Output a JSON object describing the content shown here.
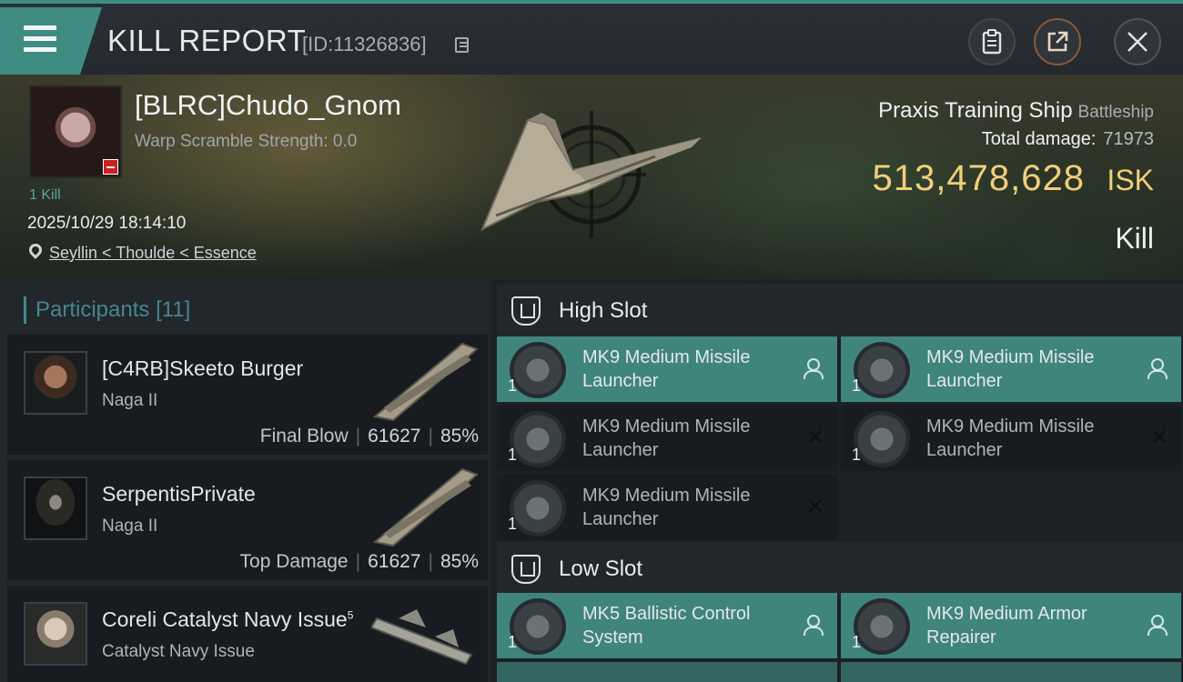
{
  "header": {
    "title": "KILL REPORT",
    "report_id": "[ID:11326836]"
  },
  "victim": {
    "pilot_name": "[BLRC]Chudo_Gnom",
    "warp_scramble": "Warp Scramble Strength: 0.0",
    "kill_count": "1 Kill",
    "datetime": "2025/10/29 18:14:10",
    "location": "Seyllin < Thoulde < Essence",
    "ship_name": "Praxis Training Ship",
    "ship_class": "Battleship",
    "total_damage_label": "Total damage:",
    "total_damage": "71973",
    "isk_value": "513,478,628",
    "isk_unit": "ISK",
    "result": "Kill"
  },
  "participants": {
    "title": "Participants",
    "count": "[11]",
    "rows": [
      {
        "name": "[C4RB]Skeeto Burger",
        "ship": "Naga II",
        "label": "Final Blow",
        "damage": "61627",
        "percent": "85%"
      },
      {
        "name": "SerpentisPrivate",
        "ship": "Naga II",
        "label": "Top Damage",
        "damage": "61627",
        "percent": "85%"
      },
      {
        "name": "Coreli Catalyst Navy Issue",
        "sup": "5",
        "ship": "Catalyst Navy Issue",
        "label": "",
        "damage": "",
        "percent": ""
      }
    ]
  },
  "slots": {
    "high": {
      "title": "High Slot",
      "modules": [
        {
          "name": "MK9 Medium Missile Launcher",
          "qty": "1",
          "state": "active"
        },
        {
          "name": "MK9 Medium Missile Launcher",
          "qty": "1",
          "state": "active"
        },
        {
          "name": "MK9 Medium Missile Launcher",
          "qty": "1",
          "state": "destroyed"
        },
        {
          "name": "MK9 Medium Missile Launcher",
          "qty": "1",
          "state": "destroyed"
        },
        {
          "name": "MK9 Medium Missile Launcher",
          "qty": "1",
          "state": "destroyed"
        }
      ]
    },
    "low": {
      "title": "Low Slot",
      "modules": [
        {
          "name": "MK5 Ballistic Control System",
          "qty": "1",
          "state": "active"
        },
        {
          "name": "MK9 Medium Armor Repairer",
          "qty": "1",
          "state": "active"
        }
      ]
    }
  },
  "colors": {
    "accent": "#3f8c83",
    "isk": "#f0cf7a",
    "module_active": "#3f857b"
  }
}
